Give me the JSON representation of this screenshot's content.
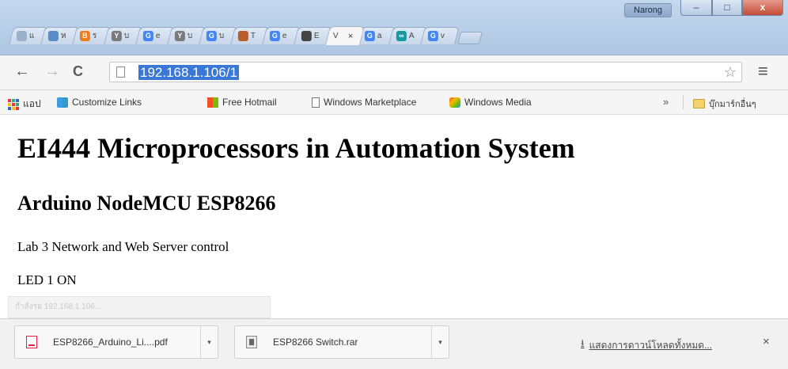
{
  "window": {
    "user_name": "Narong",
    "min_glyph": "–",
    "max_glyph": "□",
    "close_glyph": "x"
  },
  "tabs": [
    {
      "favicon": "generic-page-icon",
      "icon_letter": "",
      "label": "แ",
      "color": "#9bb0c9"
    },
    {
      "favicon": "calendar-icon",
      "icon_letter": "",
      "label": "ห",
      "color": "#5a8ac8"
    },
    {
      "favicon": "blogger-icon",
      "icon_letter": "B",
      "label": "ร",
      "color": "#f07b1a"
    },
    {
      "favicon": "y-icon",
      "icon_letter": "Y",
      "label": "บ",
      "color": "#7a7a7a"
    },
    {
      "favicon": "google-icon",
      "icon_letter": "G",
      "label": "e",
      "color": "#4285f4"
    },
    {
      "favicon": "y-icon",
      "icon_letter": "Y",
      "label": "บ",
      "color": "#7a7a7a"
    },
    {
      "favicon": "google-icon",
      "icon_letter": "G",
      "label": "บ",
      "color": "#4285f4"
    },
    {
      "favicon": "image-icon",
      "icon_letter": "",
      "label": "T",
      "color": "#b85c2a"
    },
    {
      "favicon": "google-icon",
      "icon_letter": "G",
      "label": "e",
      "color": "#4285f4"
    },
    {
      "favicon": "car-icon",
      "icon_letter": "",
      "label": "E",
      "color": "#444444"
    },
    {
      "favicon": "none",
      "icon_letter": "",
      "label": "V",
      "color": "#ffffff",
      "active": true
    },
    {
      "favicon": "google-icon",
      "icon_letter": "G",
      "label": "a",
      "color": "#4285f4"
    },
    {
      "favicon": "arduino-icon",
      "icon_letter": "∞",
      "label": "A",
      "color": "#139aa0"
    },
    {
      "favicon": "google-icon",
      "icon_letter": "G",
      "label": "v",
      "color": "#4285f4"
    }
  ],
  "active_tab_close": "×",
  "toolbar": {
    "back": "←",
    "forward": "→",
    "reload": "C",
    "url": "192.168.1.106/1",
    "bookmark_star": "☆",
    "menu": "≡"
  },
  "bookmarks": {
    "items": [
      {
        "label": "แอป",
        "icon": "apps-grid-icon"
      },
      {
        "label": "Customize Links",
        "icon": "windows-flag-icon"
      },
      {
        "label": "Free Hotmail",
        "icon": "windows-flag-icon"
      },
      {
        "label": "Windows Marketplace",
        "icon": "document-icon"
      },
      {
        "label": "Windows Media",
        "icon": "media-player-icon"
      }
    ],
    "overflow": "»",
    "other_folder": "บุ๊กมาร์กอื่นๆ"
  },
  "page": {
    "heading1": "EI444 Microprocessors in Automation System",
    "heading2": "Arduino NodeMCU ESP8266",
    "line1": "Lab 3 Network and Web Server control",
    "line2": "LED 1 ON"
  },
  "status_bar": "กำลังรอ 192.168.1.106...",
  "downloads": {
    "items": [
      {
        "name": "ESP8266_Arduino_Li....pdf",
        "type": "pdf"
      },
      {
        "name": "ESP8266 Switch.rar",
        "type": "rar"
      }
    ],
    "dropdown_glyph": "▾",
    "show_all": "แสดงการดาวน์โหลดทั้งหมด...",
    "close": "×"
  }
}
